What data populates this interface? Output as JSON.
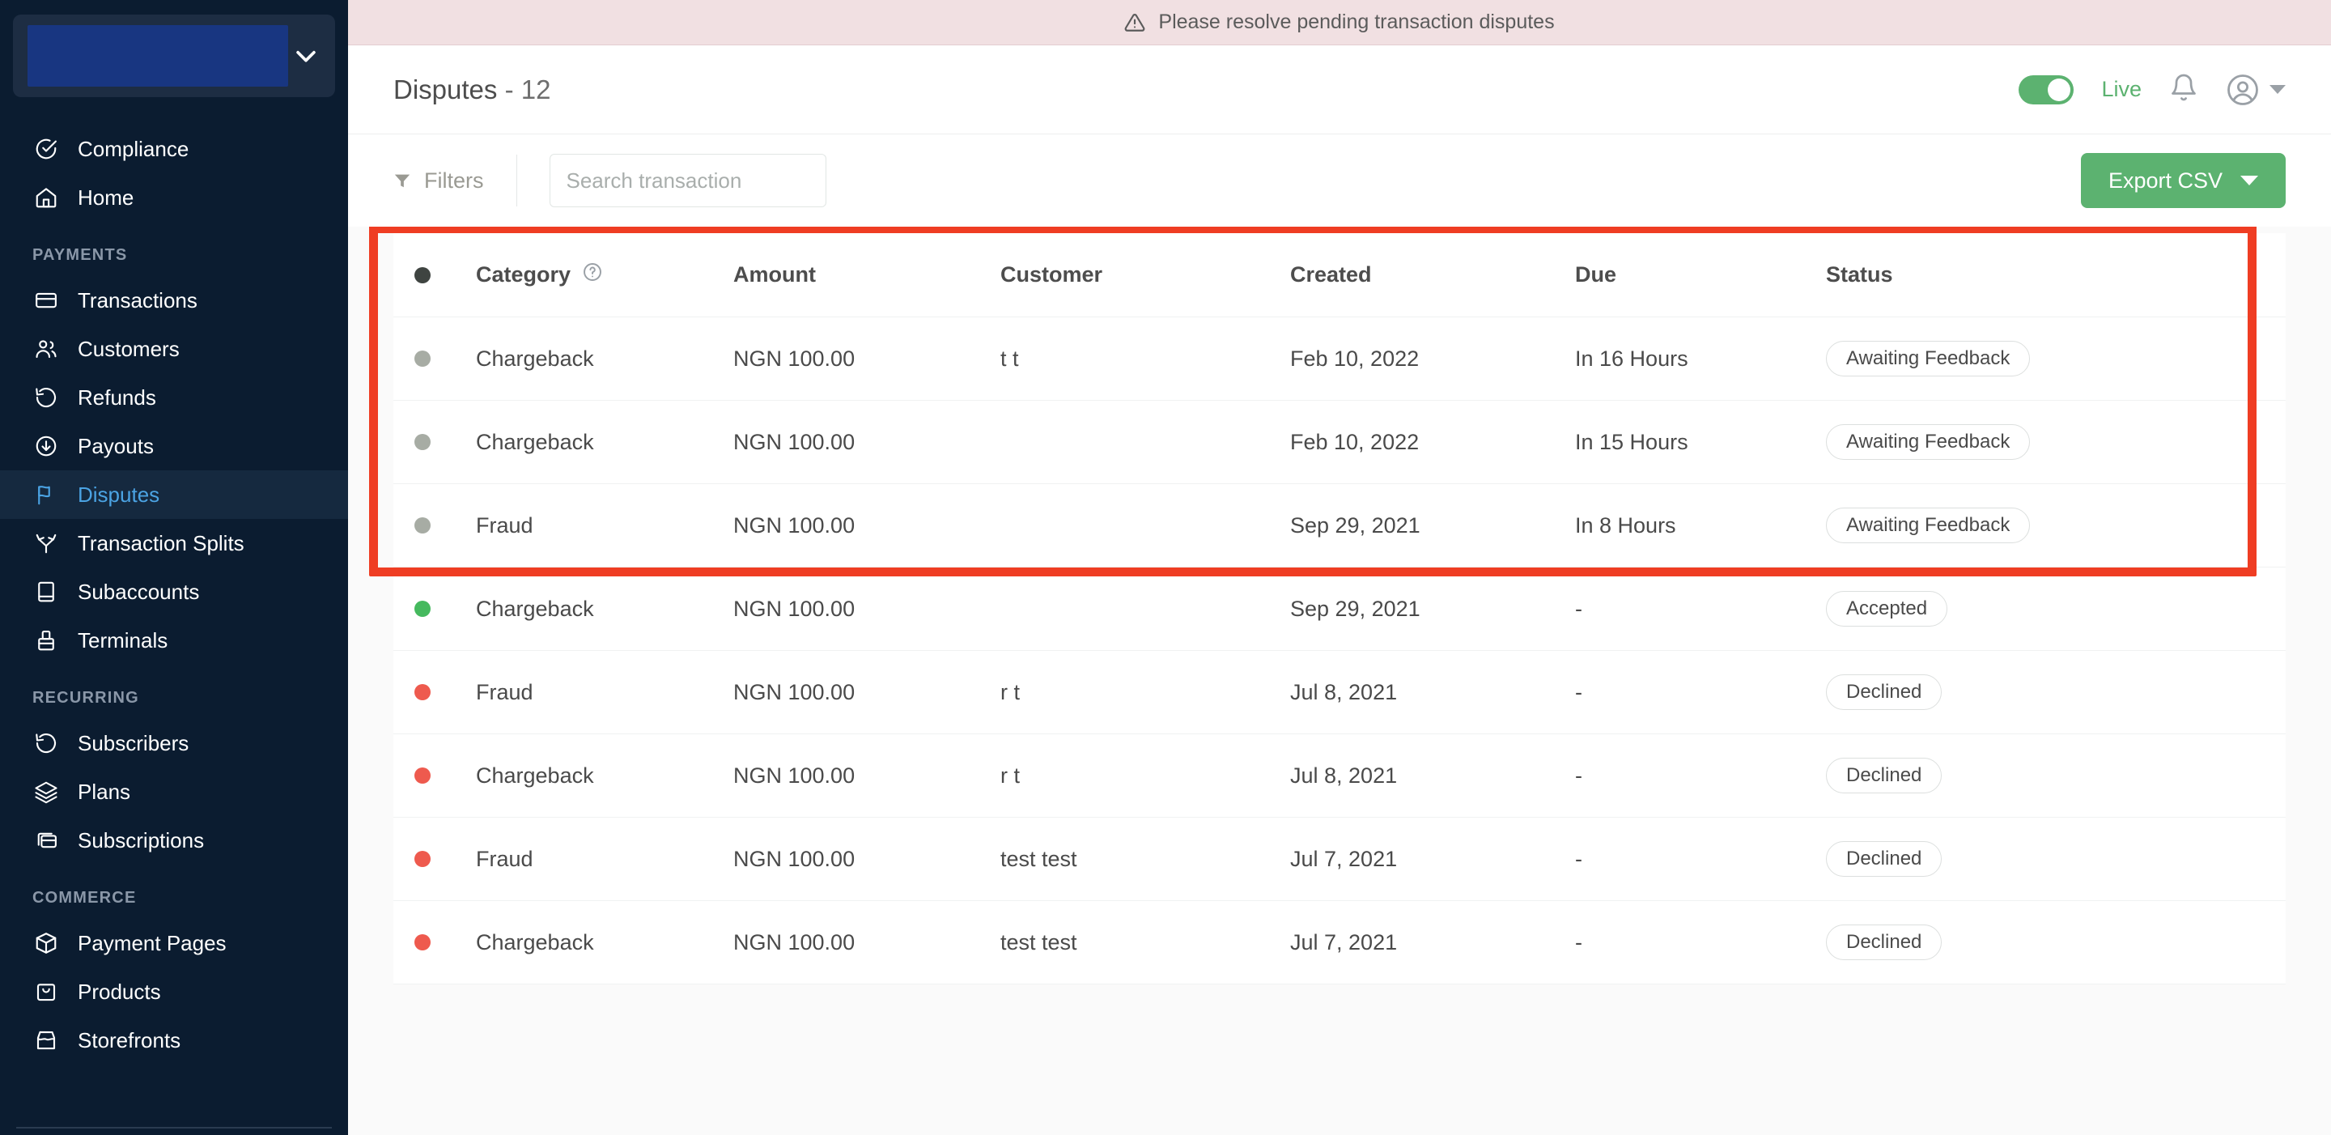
{
  "sidebar": {
    "account_switcher": {
      "name": "account-switcher",
      "redacted": true,
      "caret_icon": "chevron-down-icon"
    },
    "top_items": [
      {
        "label": "Compliance",
        "icon": "check-circle-icon",
        "active": false
      },
      {
        "label": "Home",
        "icon": "home-icon",
        "active": false
      }
    ],
    "sections": [
      {
        "title": "PAYMENTS",
        "items": [
          {
            "label": "Transactions",
            "icon": "card-icon",
            "active": false
          },
          {
            "label": "Customers",
            "icon": "users-icon",
            "active": false
          },
          {
            "label": "Refunds",
            "icon": "refund-icon",
            "active": false
          },
          {
            "label": "Payouts",
            "icon": "payout-icon",
            "active": false
          },
          {
            "label": "Disputes",
            "icon": "flag-icon",
            "active": true
          },
          {
            "label": "Transaction Splits",
            "icon": "split-icon",
            "active": false
          },
          {
            "label": "Subaccounts",
            "icon": "book-icon",
            "active": false
          },
          {
            "label": "Terminals",
            "icon": "terminal-icon",
            "active": false
          }
        ]
      },
      {
        "title": "RECURRING",
        "items": [
          {
            "label": "Subscribers",
            "icon": "refund-icon",
            "active": false
          },
          {
            "label": "Plans",
            "icon": "layers-icon",
            "active": false
          },
          {
            "label": "Subscriptions",
            "icon": "cards-stack-icon",
            "active": false
          }
        ]
      },
      {
        "title": "COMMERCE",
        "items": [
          {
            "label": "Payment Pages",
            "icon": "box-icon",
            "active": false
          },
          {
            "label": "Products",
            "icon": "bag-icon",
            "active": false
          },
          {
            "label": "Storefronts",
            "icon": "store-icon",
            "active": false
          }
        ]
      }
    ]
  },
  "alert": {
    "icon": "warning-triangle-icon",
    "message": "Please resolve pending transaction disputes"
  },
  "header": {
    "title": "Disputes",
    "separator": "-",
    "count": "12",
    "mode_toggle": {
      "label": "Live",
      "on": true
    },
    "bell_icon": "bell-icon",
    "avatar_icon": "user-circle-icon",
    "avatar_caret_icon": "caret-down-icon"
  },
  "toolbar": {
    "filters_label": "Filters",
    "filters_icon": "funnel-icon",
    "search": {
      "value": "",
      "placeholder": "Search transaction"
    },
    "export_label": "Export CSV",
    "export_caret_icon": "caret-down-icon"
  },
  "table": {
    "columns": [
      {
        "key": "dot",
        "label": ""
      },
      {
        "key": "category",
        "label": "Category",
        "help_icon": "question-circle-icon"
      },
      {
        "key": "amount",
        "label": "Amount"
      },
      {
        "key": "customer",
        "label": "Customer"
      },
      {
        "key": "created",
        "label": "Created"
      },
      {
        "key": "due",
        "label": "Due"
      },
      {
        "key": "status",
        "label": "Status"
      }
    ],
    "rows": [
      {
        "dot": "grey",
        "category": "Chargeback",
        "amount": "NGN 100.00",
        "customer": "t t",
        "customer_redacted": false,
        "created": "Feb 10, 2022",
        "due": "In 16 Hours",
        "status": "Awaiting Feedback"
      },
      {
        "dot": "grey",
        "category": "Chargeback",
        "amount": "NGN 100.00",
        "customer": "",
        "customer_redacted": true,
        "created": "Feb 10, 2022",
        "due": "In 15 Hours",
        "status": "Awaiting Feedback"
      },
      {
        "dot": "grey",
        "category": "Fraud",
        "amount": "NGN 100.00",
        "customer": "",
        "customer_redacted": true,
        "created": "Sep 29, 2021",
        "due": "In 8 Hours",
        "status": "Awaiting Feedback"
      },
      {
        "dot": "green",
        "category": "Chargeback",
        "amount": "NGN 100.00",
        "customer": "",
        "customer_redacted": true,
        "created": "Sep 29, 2021",
        "due": "-",
        "status": "Accepted"
      },
      {
        "dot": "red",
        "category": "Fraud",
        "amount": "NGN 100.00",
        "customer": "r t",
        "customer_redacted": false,
        "created": "Jul 8, 2021",
        "due": "-",
        "status": "Declined"
      },
      {
        "dot": "red",
        "category": "Chargeback",
        "amount": "NGN 100.00",
        "customer": "r t",
        "customer_redacted": false,
        "created": "Jul 8, 2021",
        "due": "-",
        "status": "Declined"
      },
      {
        "dot": "red",
        "category": "Fraud",
        "amount": "NGN 100.00",
        "customer": "test test",
        "customer_redacted": false,
        "created": "Jul 7, 2021",
        "due": "-",
        "status": "Declined"
      },
      {
        "dot": "red",
        "category": "Chargeback",
        "amount": "NGN 100.00",
        "customer": "test test",
        "customer_redacted": false,
        "created": "Jul 7, 2021",
        "due": "-",
        "status": "Declined"
      }
    ],
    "highlight": {
      "color": "#ef3d23",
      "first_row_index": 0,
      "last_row_index": 2
    }
  }
}
